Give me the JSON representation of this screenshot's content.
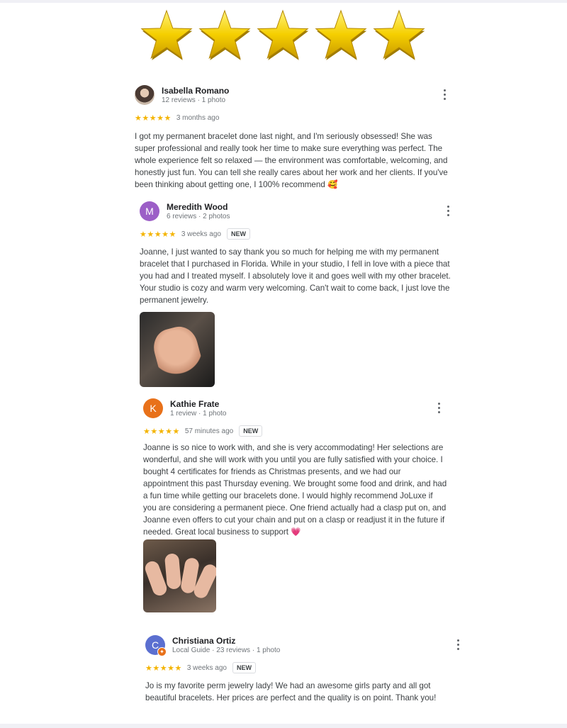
{
  "colors": {
    "star_gold": "#f5cf00",
    "mini_star": "#f4b400",
    "avatar_meredith": "#9c5fc7",
    "avatar_kathie": "#e8711a",
    "avatar_christiana": "#5b6fd0",
    "heart": "#e91e63"
  },
  "header": {
    "rating": 5,
    "icon": "star-icon"
  },
  "reviews": [
    {
      "name": "Isabella Romano",
      "meta": "12 reviews · 1 photo",
      "avatar_letter": "",
      "stars": "★★★★★",
      "time": "3 months ago",
      "new_label": "",
      "text": "I got my permanent bracelet done last night, and I'm seriously obsessed! She was super professional and really took her time to make sure everything was perfect. The whole experience felt so relaxed — the environment was comfortable, welcoming, and honestly just fun. You can tell she really cares about her work and her clients. If you've been thinking about getting one, I 100% recommend",
      "emoji": "🥰"
    },
    {
      "name": "Meredith Wood",
      "meta": "6 reviews · 2 photos",
      "avatar_letter": "M",
      "stars": "★★★★★",
      "time": "3 weeks ago",
      "new_label": "NEW",
      "text": "Joanne, I just wanted to say thank you so much for helping me with my permanent bracelet that I purchased in Florida. While in your studio, I fell in love with a piece that you had and I treated myself. I absolutely love it and goes well with my other bracelet. Your studio is cozy and warm very welcoming. Can't wait to come back, I just love the permanent jewelry."
    },
    {
      "name": "Kathie Frate",
      "meta": "1 review · 1 photo",
      "avatar_letter": "K",
      "stars": "★★★★★",
      "time": "57 minutes ago",
      "new_label": "NEW",
      "text": "Joanne is so nice to work with, and she is very accommodating! Her selections are wonderful, and she will work with you until you are fully satisfied with your choice. I bought 4 certificates for friends as Christmas presents, and we had our appointment this past Thursday evening. We brought some food and drink, and had a fun time while getting our bracelets done. I would highly recommend JoLuxe if you are considering a permanent piece. One friend actually had a clasp put on, and Joanne even offers to cut your chain and put on a clasp or readjust it in the future if needed. Great local business to support",
      "emoji": "💗"
    },
    {
      "name": "Christiana Ortiz",
      "meta": "Local Guide · 23 reviews · 1 photo",
      "avatar_letter": "C",
      "stars": "★★★★★",
      "time": "3 weeks ago",
      "new_label": "NEW",
      "text": "Jo is my favorite perm jewelry lady! We had an awesome girls party and all got beautiful bracelets. Her prices are perfect and the quality is on point. Thank you!"
    }
  ]
}
